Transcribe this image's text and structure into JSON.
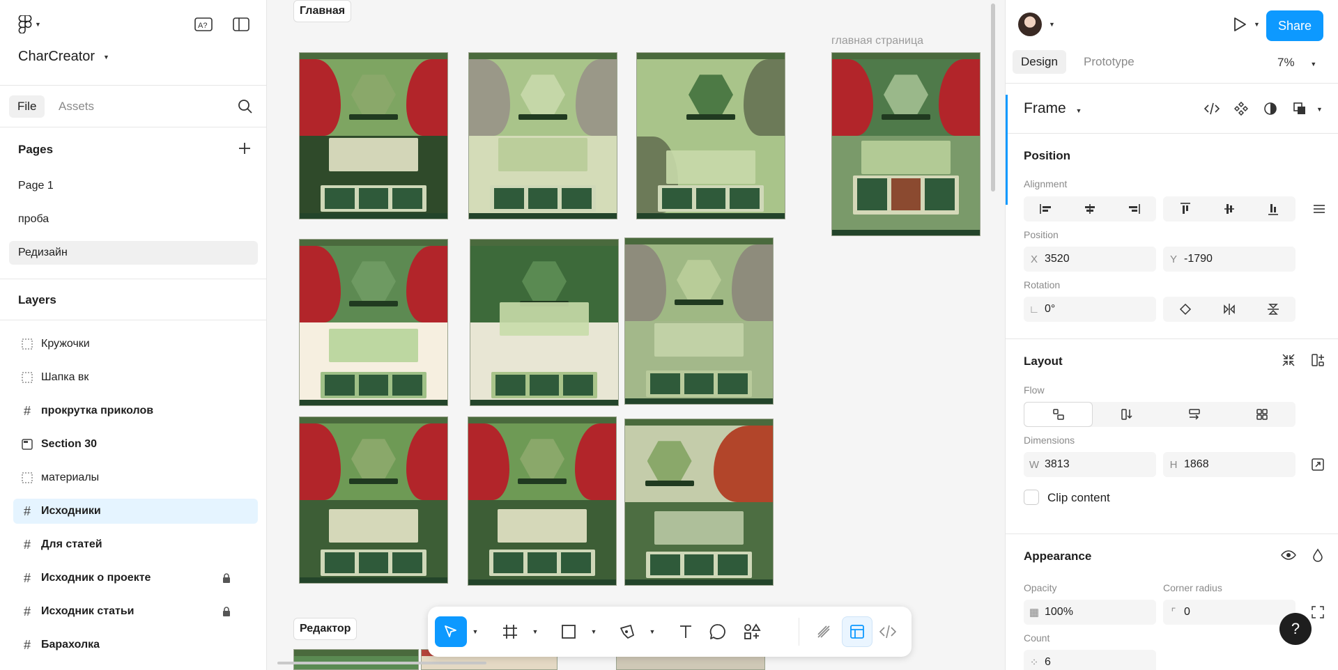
{
  "app": {
    "project_name": "CharCreator",
    "left_tabs": [
      "File",
      "Assets"
    ],
    "pages_title": "Pages",
    "pages": [
      "Page 1",
      "проба",
      "Редизайн"
    ],
    "layers_title": "Layers",
    "layers": [
      {
        "name": "Кружочки",
        "icon": "dashed-frame-icon",
        "bold": false,
        "locked": false
      },
      {
        "name": "Шапка вк",
        "icon": "dashed-frame-icon",
        "bold": false,
        "locked": false
      },
      {
        "name": "прокрутка приколов",
        "icon": "frame-hash-icon",
        "bold": true,
        "locked": false
      },
      {
        "name": "Section 30",
        "icon": "section-icon",
        "bold": true,
        "locked": false
      },
      {
        "name": "материалы",
        "icon": "dashed-frame-icon",
        "bold": false,
        "locked": false
      },
      {
        "name": "Исходники",
        "icon": "frame-hash-icon",
        "bold": true,
        "locked": false
      },
      {
        "name": "Для статей",
        "icon": "frame-hash-icon",
        "bold": true,
        "locked": false
      },
      {
        "name": "Исходник о проекте",
        "icon": "frame-hash-icon",
        "bold": true,
        "locked": true
      },
      {
        "name": "Исходник статьи",
        "icon": "frame-hash-icon",
        "bold": true,
        "locked": true
      },
      {
        "name": "Барахолка",
        "icon": "frame-hash-icon",
        "bold": true,
        "locked": false
      }
    ]
  },
  "canvas": {
    "section_main": "Главная",
    "section_editor": "Редактор",
    "frame_label": "главная страница",
    "palette": {
      "dark_green": "#2f4a2a",
      "mid_green": "#7ea562",
      "light_green": "#a9c48a",
      "cream": "#f6efe0",
      "red_skin": "#b2252a",
      "grey_skin": "#9a9888"
    }
  },
  "toolbar": {
    "tools": [
      "move-tool-icon",
      "frame-tool-icon",
      "rectangle-tool-icon",
      "pen-tool-icon",
      "text-tool-icon",
      "comment-tool-icon",
      "actions-icon",
      "draw-mode-icon",
      "design-mode-icon",
      "dev-mode-icon"
    ]
  },
  "design": {
    "share_label": "Share",
    "tabs": [
      "Design",
      "Prototype"
    ],
    "zoom": "7%",
    "frame_label": "Frame",
    "position_title": "Position",
    "alignment_label": "Alignment",
    "position_label": "Position",
    "x_prefix": "X",
    "x": "3520",
    "y_prefix": "Y",
    "y": "-1790",
    "rotation_label": "Rotation",
    "rotation": "0°",
    "layout_title": "Layout",
    "flow_label": "Flow",
    "dimensions_label": "Dimensions",
    "w_prefix": "W",
    "w": "3813",
    "h_prefix": "H",
    "h": "1868",
    "clip_label": "Clip content",
    "appearance_title": "Appearance",
    "opacity_label": "Opacity",
    "opacity": "100%",
    "radius_label": "Corner radius",
    "radius": "0",
    "count_label": "Count",
    "count": "6",
    "help": "?"
  }
}
